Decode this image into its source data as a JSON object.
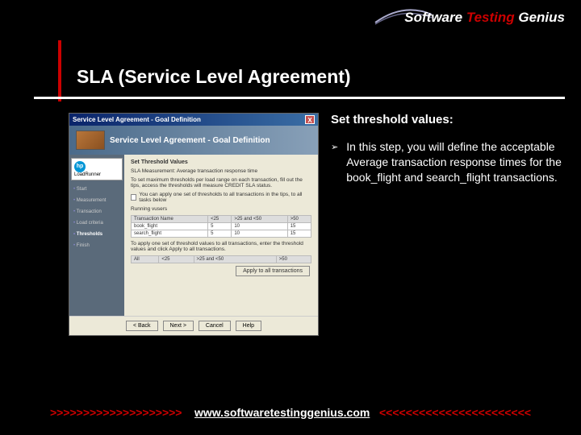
{
  "logo": {
    "w1": "Software",
    "w2": "Testing",
    "w3": "Genius"
  },
  "title": "SLA (Service Level Agreement)",
  "rhs": {
    "heading": "Set threshold values:",
    "bullet": "In this step, you will define the acceptable Average transaction response times for the book_flight and search_flight transactions."
  },
  "wizard": {
    "titlebar": "Service Level Agreement - Goal Definition",
    "close": "X",
    "banner": "Service Level Agreement - Goal Definition",
    "side": {
      "product": "LoadRunner",
      "items": [
        "Start",
        "Measurement",
        "Transaction",
        "Load criteria",
        "Thresholds",
        "Finish"
      ],
      "active_index": 4
    },
    "main": {
      "section": "Set Threshold Values",
      "line1": "SLA Measurement:",
      "line1_val": "Average transaction response time",
      "line2": "To set maximum thresholds per load range on each transaction, fill out the tips, access the thresholds will measure CREDIT SLA status.",
      "checkbox": "You can apply one set of thresholds to all transactions in the tips, to all tasks below",
      "group_label": "Running vusers",
      "table": {
        "cols": [
          "Transaction Name",
          "<25",
          ">25 and <50",
          ">50"
        ],
        "rows": [
          [
            "book_flight",
            "5",
            "10",
            "15"
          ],
          [
            "search_flight",
            "5",
            "10",
            "15"
          ]
        ]
      },
      "line3": "To apply one set of threshold values to all transactions, enter the threshold values and click Apply to all transactions.",
      "apply_row": [
        "All",
        "<25",
        ">25 and <50",
        ">50"
      ],
      "apply_btn": "Apply to all transactions"
    },
    "buttons": {
      "back": "< Back",
      "next": "Next >",
      "cancel": "Cancel",
      "help": "Help"
    }
  },
  "footer": {
    "left": ">>>>>>>>>>>>>>>>>>>>",
    "link": "www.softwaretestinggenius.com",
    "right": "<<<<<<<<<<<<<<<<<<<<<<<"
  }
}
